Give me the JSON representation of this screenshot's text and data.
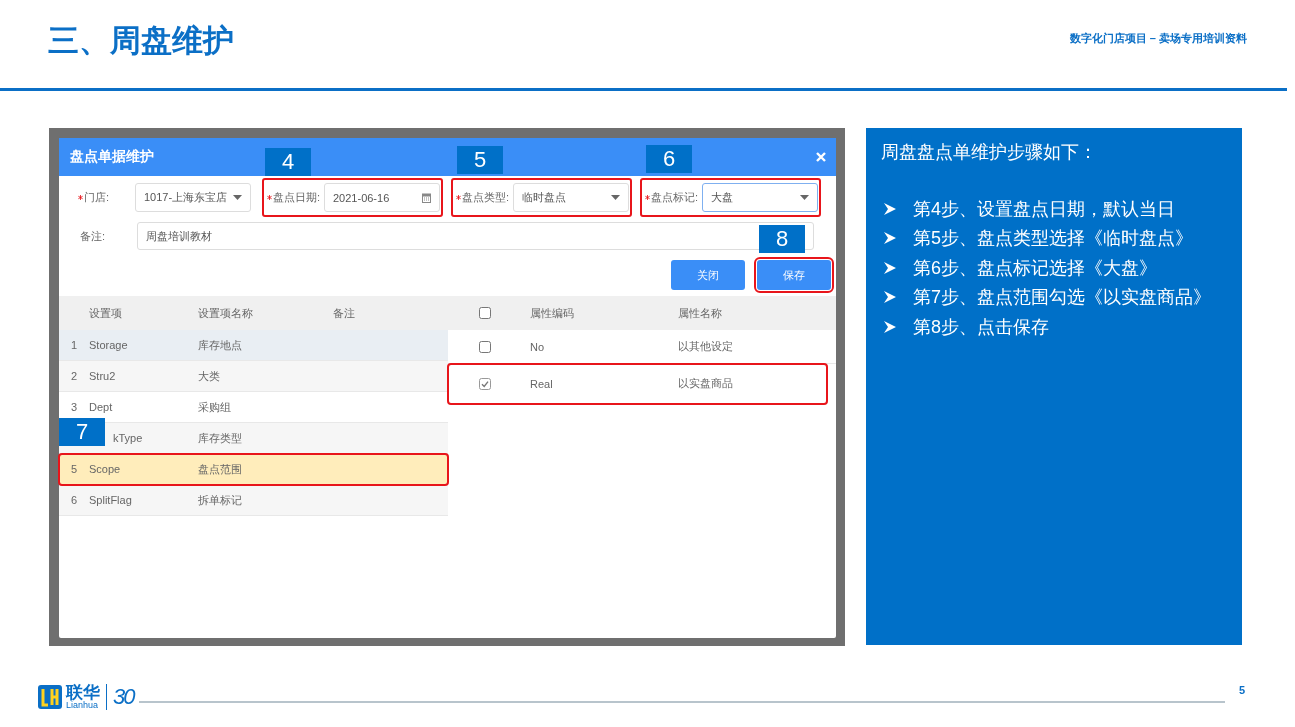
{
  "header": {
    "title": "三、周盘维护",
    "subtitle": "数字化门店项目 – 卖场专用培训资料"
  },
  "dialog": {
    "title": "盘点单据维护",
    "fields": [
      {
        "label": "门店:",
        "required": true,
        "value": "1017-上海东宝店",
        "kind": "select",
        "focused": false,
        "highlighted": false
      },
      {
        "label": "盘点日期:",
        "required": true,
        "value": "2021-06-16",
        "kind": "date",
        "focused": false,
        "highlighted": true
      },
      {
        "label": "盘点类型:",
        "required": true,
        "value": "临时盘点",
        "kind": "select",
        "focused": false,
        "highlighted": true
      },
      {
        "label": "盘点标记:",
        "required": true,
        "value": "大盘",
        "kind": "select",
        "focused": true,
        "highlighted": true
      }
    ],
    "remark": {
      "label": "备注:",
      "value": "周盘培训教材"
    },
    "buttons": [
      {
        "label": "关闭",
        "highlighted": false
      },
      {
        "label": "保存",
        "highlighted": true
      }
    ],
    "settings_table": {
      "columns": [
        "设置项",
        "设置项名称",
        "备注"
      ],
      "rows": [
        {
          "index": "1",
          "code": "Storage",
          "name": "库存地点",
          "hovered": true,
          "selected": false,
          "highlighted": false
        },
        {
          "index": "2",
          "code": "Stru2",
          "name": "大类",
          "hovered": false,
          "selected": false,
          "highlighted": false
        },
        {
          "index": "3",
          "code": "Dept",
          "name": "采购组",
          "hovered": false,
          "selected": false,
          "highlighted": false
        },
        {
          "code": "kType",
          "name": "库存类型",
          "hovered": false,
          "selected": false,
          "highlighted": false
        },
        {
          "index": "5",
          "code": "Scope",
          "name": "盘点范围",
          "hovered": false,
          "selected": true,
          "highlighted": true
        },
        {
          "index": "6",
          "code": "SplitFlag",
          "name": "拆单标记",
          "hovered": false,
          "selected": false,
          "highlighted": false
        }
      ]
    },
    "attributes_table": {
      "all_checked": false,
      "columns": [
        "属性编码",
        "属性名称"
      ],
      "rows": [
        {
          "code": "No",
          "name": "以其他设定",
          "checked": false,
          "highlighted": false
        },
        {
          "code": "Real",
          "name": "以实盘商品",
          "checked": true,
          "highlighted": true
        }
      ]
    },
    "markers": [
      {
        "label": "4"
      },
      {
        "label": "5"
      },
      {
        "label": "6"
      },
      {
        "label": "8"
      },
      {
        "label": "7"
      }
    ]
  },
  "instructions": {
    "title": "周盘盘点单维护步骤如下：",
    "steps": [
      "第4步、设置盘点日期，默认当日",
      "第5步、盘点类型选择《临时盘点》",
      "第6步、盘点标记选择《大盘》",
      "第7步、盘点范围勾选《以实盘商品》",
      "第8步、点击保存"
    ]
  },
  "footer": {
    "brand": "联华",
    "brand_latin": "Lianhua",
    "anniversary": "30",
    "page": "5"
  }
}
